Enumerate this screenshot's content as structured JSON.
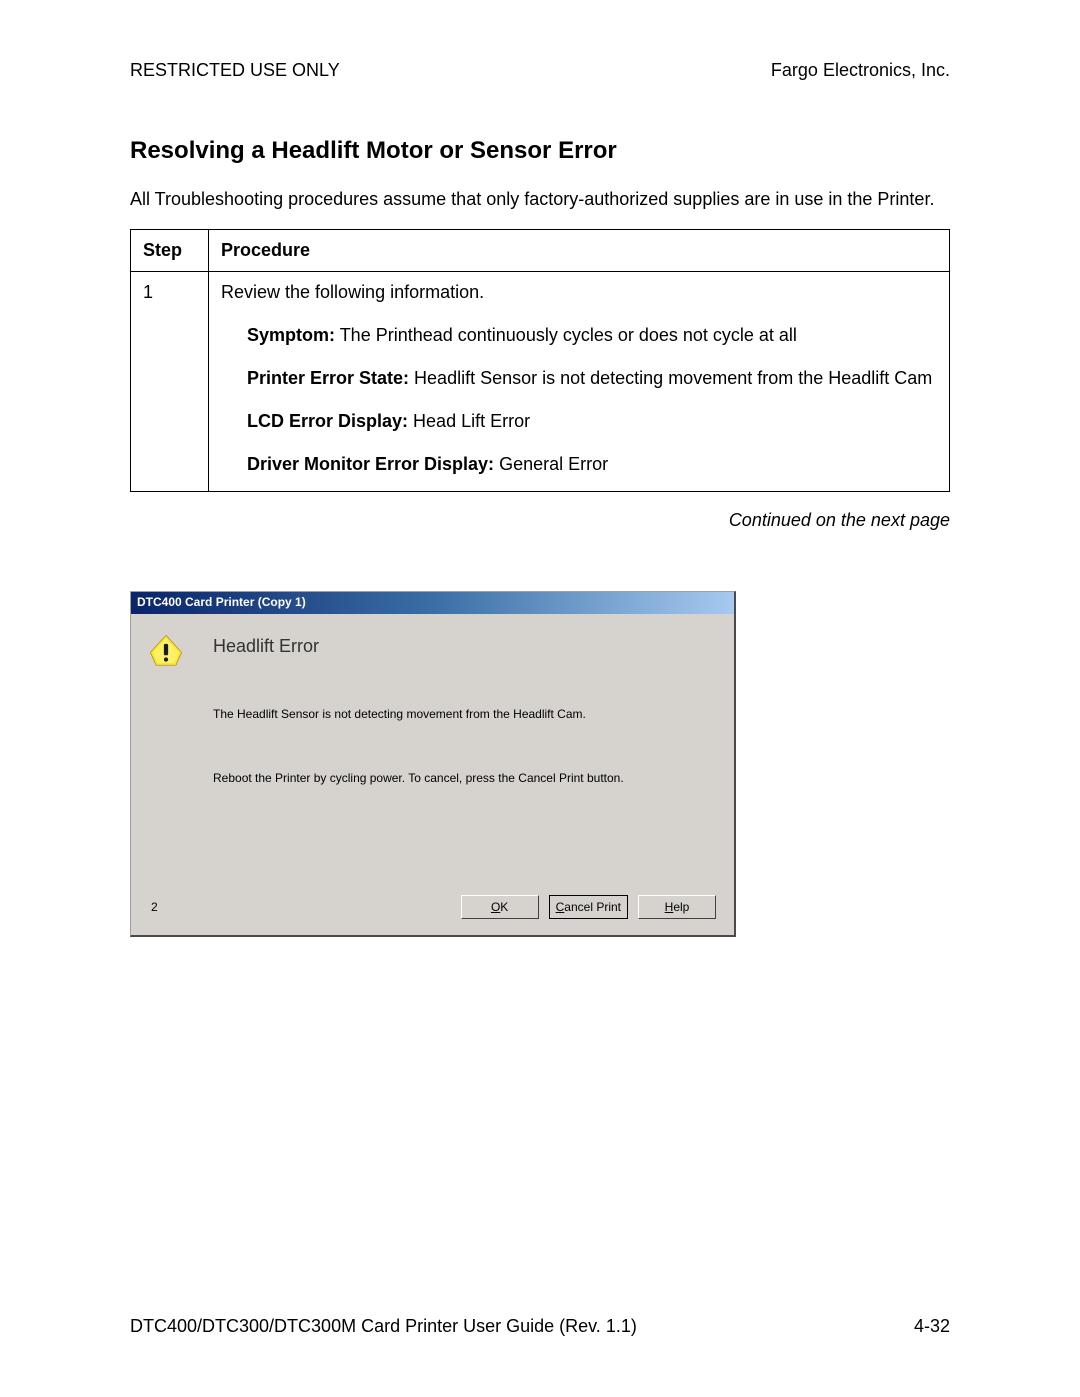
{
  "header": {
    "left": "RESTRICTED USE ONLY",
    "right": "Fargo Electronics, Inc."
  },
  "title": "Resolving a Headlift Motor or Sensor Error",
  "intro": "All Troubleshooting procedures assume that only factory-authorized supplies are in use in the Printer.",
  "table": {
    "headers": {
      "step": "Step",
      "procedure": "Procedure"
    },
    "row1": {
      "step": "1",
      "line1": "Review the following information.",
      "symptom_label": "Symptom:",
      "symptom_text": " The Printhead continuously cycles or does not cycle at all",
      "state_label": "Printer Error State:",
      "state_text": " Headlift Sensor is not detecting movement from the Headlift Cam",
      "lcd_label": "LCD Error Display:",
      "lcd_text": " Head Lift Error",
      "driver_label": "Driver Monitor Error Display:",
      "driver_text": " General Error"
    }
  },
  "continued": "Continued on the next page",
  "dialog": {
    "title": "DTC400 Card Printer (Copy 1)",
    "heading": "Headlift Error",
    "msg1": "The Headlift Sensor is not detecting movement from the Headlift Cam.",
    "msg2": "Reboot the Printer by cycling power. To cancel, press the Cancel Print button.",
    "count": "2",
    "buttons": {
      "ok_u": "O",
      "ok_rest": "K",
      "cancel_u": "C",
      "cancel_rest": "ancel Print",
      "help_u": "H",
      "help_rest": "elp"
    }
  },
  "footer": {
    "left": "DTC400/DTC300/DTC300M Card Printer User Guide (Rev. 1.1)",
    "right": "4-32"
  }
}
